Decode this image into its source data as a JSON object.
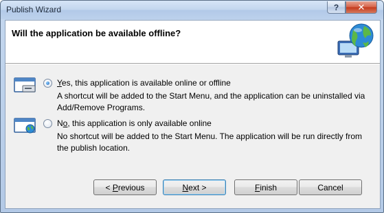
{
  "window": {
    "title": "Publish Wizard",
    "help_glyph": "?",
    "close_glyph": "✕"
  },
  "header": {
    "title": "Will the application be available offline?"
  },
  "options": [
    {
      "label_mnemonic": "Y",
      "label_rest": "es, this application is available online or offline",
      "description": "A shortcut will be added to the Start Menu, and the application can be uninstalled via Add/Remove Programs.",
      "selected": true,
      "icon": "computer-drive-icon"
    },
    {
      "label_mnemonic": "o",
      "label_prefix": "N",
      "label_rest": ", this application is only available online",
      "description": "No shortcut will be added to the Start Menu. The application will be run directly from the publish location.",
      "selected": false,
      "icon": "computer-globe-icon"
    }
  ],
  "buttons": {
    "previous": {
      "prefix": "< ",
      "mnemonic": "P",
      "rest": "revious"
    },
    "next": {
      "mnemonic": "N",
      "rest": "ext >"
    },
    "finish": {
      "mnemonic": "F",
      "rest": "inish"
    },
    "cancel": {
      "label": "Cancel"
    }
  },
  "colors": {
    "accent": "#3c7fb1",
    "title_bar": "#c3d6ee",
    "close_button": "#c43a1c"
  }
}
